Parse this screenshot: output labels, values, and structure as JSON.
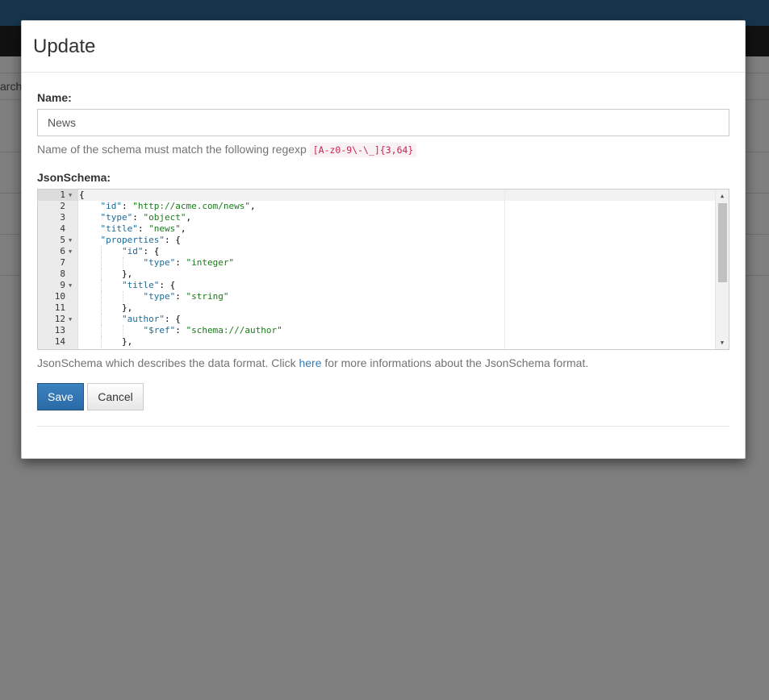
{
  "background": {
    "search_placeholder": "arch"
  },
  "modal": {
    "title": "Update",
    "name_label": "Name:",
    "name_value": "News",
    "name_help": "Name of the schema must match the following regexp",
    "name_regexp": "[A-z0-9\\-\\_]{3,64}",
    "schema_label": "JsonSchema:",
    "schema_help_before": "JsonSchema which describes the data format. Click",
    "schema_help_link": "here",
    "schema_help_after": "for more informations about the JsonSchema format.",
    "save_label": "Save",
    "cancel_label": "Cancel"
  },
  "editor": {
    "line_numbers": [
      "1",
      "2",
      "3",
      "4",
      "5",
      "6",
      "7",
      "8",
      "9",
      "10",
      "11",
      "12",
      "13",
      "14"
    ],
    "fold_lines": [
      "1",
      "5",
      "6",
      "9",
      "12"
    ],
    "lines": [
      "{",
      "    \"id\": \"http://acme.com/news\",",
      "    \"type\": \"object\",",
      "    \"title\": \"news\",",
      "    \"properties\": {",
      "        \"id\": {",
      "            \"type\": \"integer\"",
      "        },",
      "        \"title\": {",
      "            \"type\": \"string\"",
      "        },",
      "        \"author\": {",
      "            \"$ref\": \"schema:///author\"",
      "        },"
    ]
  },
  "colors": {
    "primary": "#337ab7",
    "topbar": "#2d6a9a",
    "navbar": "#222222",
    "json_key": "#1a6b9a",
    "json_string": "#1a7a1a",
    "code_red": "#c7254e"
  }
}
